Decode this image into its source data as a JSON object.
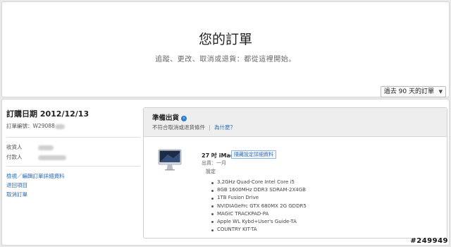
{
  "header": {
    "title": "您的訂單",
    "subtitle": "追蹤、更改、取消或退貨：都從這裡開始。",
    "period_selected": "過去 90 天的訂單"
  },
  "order": {
    "date": "訂購日期 2012/12/13",
    "number_label": "訂單編號：",
    "number_visible": "W29088",
    "recipient_label": "收貨人",
    "payer_label": "付款人",
    "links": [
      "檢視／編輯訂單詳細資料",
      "退回項目",
      "取消訂單"
    ]
  },
  "shipment": {
    "status": "準備出貨",
    "note": "不符合取消或退貨條件",
    "why_link": "為什麼？",
    "product_name": "27 吋 iMac",
    "hide_button": "隱藏設定詳細資料",
    "ship_date": "出貨：一月",
    "config_label": "設定",
    "specs": [
      "3.2GHz Quad-Core Intel Core i5",
      "8GB 1600MHz DDR3 SDRAM-2X4GB",
      "1TB Fusion Drive",
      "NVIDIAGeFrc GTX 680MX 2G GDDR5",
      "MAGIC TRACKPAD-PA",
      "Apple WL Kybd+User's Guide-TA",
      "COUNTRY KIT-TA"
    ]
  },
  "watermark": "#249949"
}
